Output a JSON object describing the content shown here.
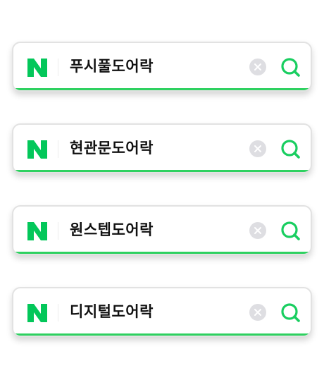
{
  "colors": {
    "brand_green": "#03c75a",
    "search_icon_green": "#19ce60",
    "bottom_line": "#2ed160",
    "clear_button": "#dedee2"
  },
  "search_bars": [
    {
      "logo_icon": "naver-n-logo-icon",
      "query": "푸시풀도어락",
      "clear_icon": "clear-x-icon",
      "search_icon": "search-magnifier-icon"
    },
    {
      "logo_icon": "naver-n-logo-icon",
      "query": "현관문도어락",
      "clear_icon": "clear-x-icon",
      "search_icon": "search-magnifier-icon"
    },
    {
      "logo_icon": "naver-n-logo-icon",
      "query": "원스텝도어락",
      "clear_icon": "clear-x-icon",
      "search_icon": "search-magnifier-icon"
    },
    {
      "logo_icon": "naver-n-logo-icon",
      "query": "디지털도어락",
      "clear_icon": "clear-x-icon",
      "search_icon": "search-magnifier-icon"
    }
  ]
}
